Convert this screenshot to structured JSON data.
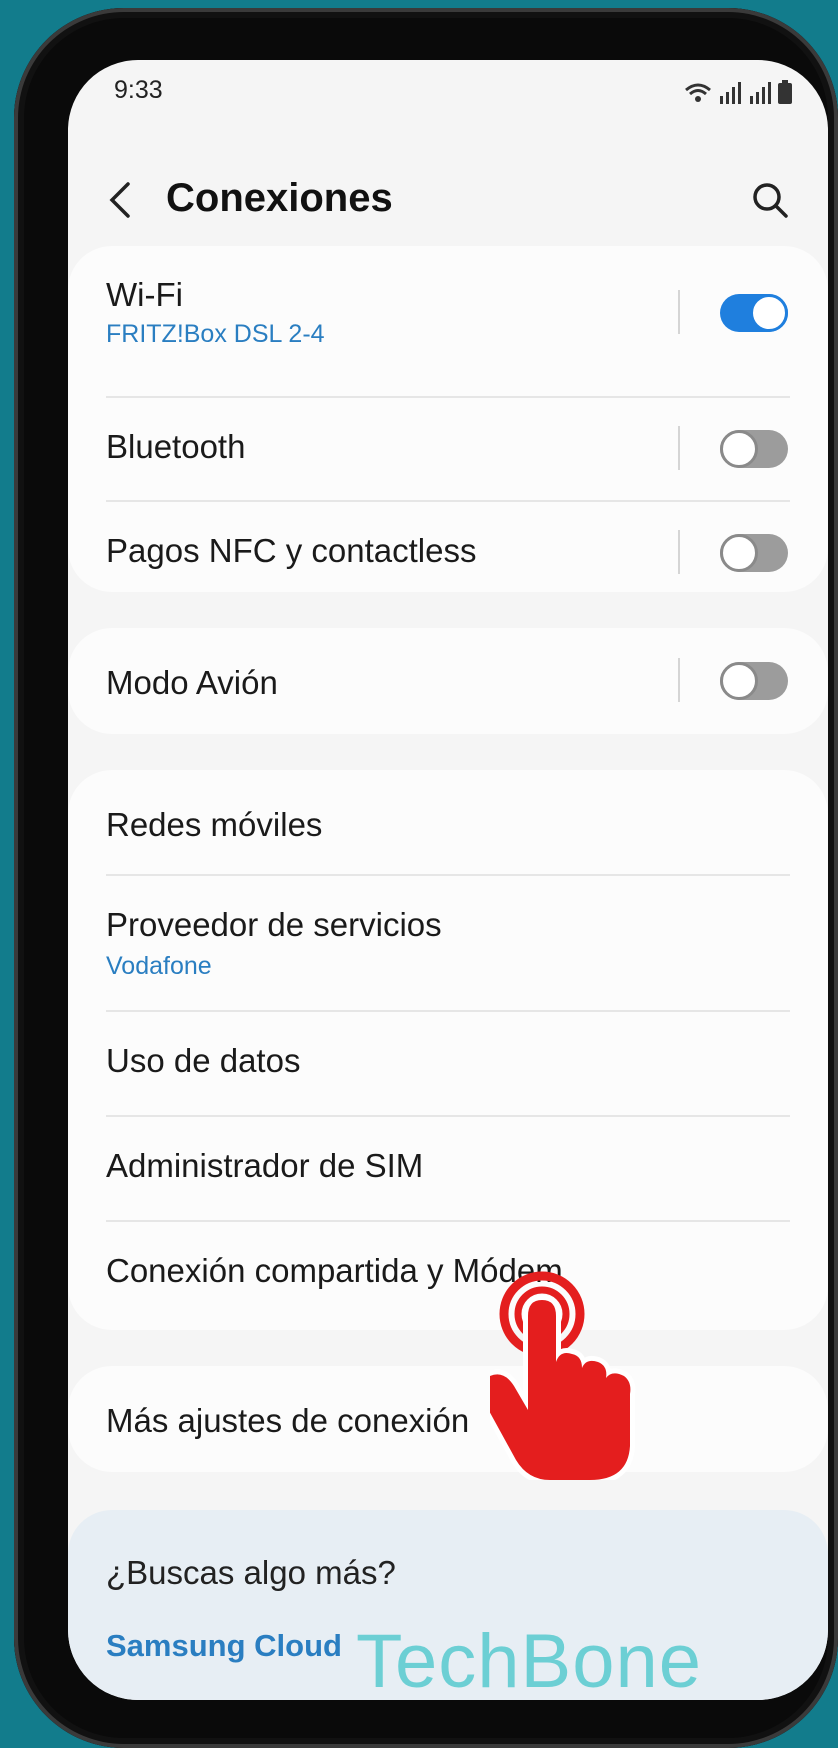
{
  "status": {
    "time": "9:33"
  },
  "header": {
    "title": "Conexiones"
  },
  "group1": {
    "wifi": {
      "label": "Wi-Fi",
      "network": "FRITZ!Box DSL 2-4",
      "on": true
    },
    "bluetooth": {
      "label": "Bluetooth",
      "on": false
    },
    "nfc": {
      "label": "Pagos NFC y contactless",
      "on": false
    }
  },
  "group2": {
    "airplane": {
      "label": "Modo Avión",
      "on": false
    }
  },
  "group3": {
    "mobile_networks": "Redes móviles",
    "provider": {
      "label": "Proveedor de servicios",
      "value": "Vodafone"
    },
    "data_usage": "Uso de datos",
    "sim_manager": "Administrador de SIM",
    "hotspot": "Conexión compartida y Módem"
  },
  "group4": {
    "more": "Más ajustes de conexión"
  },
  "looking": {
    "question": "¿Buscas algo más?",
    "link": "Samsung Cloud"
  },
  "watermark": "TechBone",
  "colors": {
    "accent": "#1f7fde",
    "link": "#2a7ec1",
    "background": "#127c8c",
    "tap_hand": "#e41e1e"
  }
}
